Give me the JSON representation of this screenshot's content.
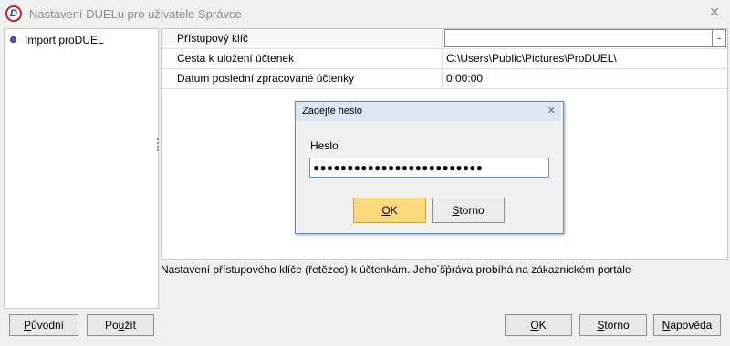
{
  "window": {
    "title": "Nastavení DUELu pro uživatele Správce",
    "icon_letter": "D"
  },
  "tree": {
    "items": [
      {
        "label": "Import proDUEL"
      }
    ]
  },
  "properties": [
    {
      "name": "Přístupový klíč",
      "value": ""
    },
    {
      "name": "Cesta k uložení účtenek",
      "value": "C:\\Users\\Public\\Pictures\\ProDUEL\\"
    },
    {
      "name": "Datum poslední zpracované účtenky",
      "value": "0:00:00"
    }
  ],
  "ellipsis_label": "...",
  "description": "Nastavení přístupového klíče (řetězec) k účtenkám. Jeho správa probíhá na zákaznickém portále",
  "footer": {
    "original_accel": "P",
    "original_rest": "ůvodní",
    "apply_prefix": "Po",
    "apply_accel": "u",
    "apply_rest": "žít",
    "ok_accel": "O",
    "ok_rest": "K",
    "cancel_accel": "S",
    "cancel_rest": "torno",
    "help_accel": "N",
    "help_rest": "ápověda"
  },
  "dialog": {
    "title": "Zadejte heslo",
    "close": "✕",
    "label": "Heslo",
    "value": "●●●●●●●●●●●●●●●●●●●●●●●●●",
    "ok_accel": "O",
    "ok_rest": "K",
    "cancel_accel": "S",
    "cancel_rest": "torno"
  },
  "colors": {
    "dialog_titlebar": "#dce6f4",
    "ok_default_button": "#fcd97a",
    "input_focus_border": "#5a8ed0"
  }
}
